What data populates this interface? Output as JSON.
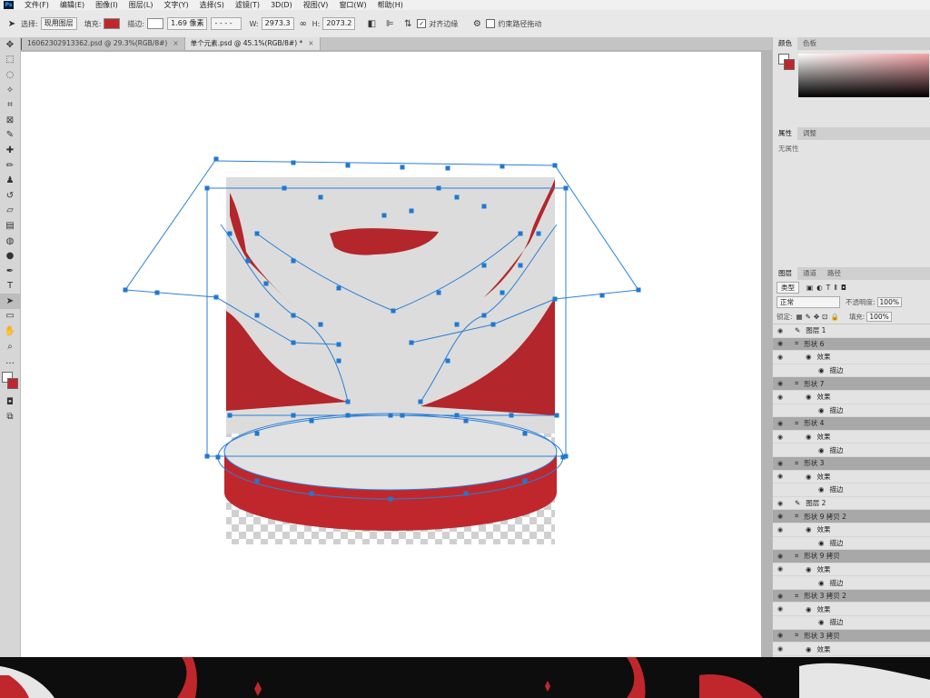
{
  "menu": [
    "文件(F)",
    "编辑(E)",
    "图像(I)",
    "图层(L)",
    "文字(Y)",
    "选择(S)",
    "滤镜(T)",
    "3D(D)",
    "视图(V)",
    "窗口(W)",
    "帮助(H)"
  ],
  "options": {
    "pick_label": "选择:",
    "pick_value": "现用图层",
    "fill_label": "填充:",
    "fill_color": "#c0272d",
    "stroke_label": "描边:",
    "stroke_width": "1.69 像素",
    "w_label": "W:",
    "w_value": "2973.3",
    "h_label": "H:",
    "h_value": "2073.2",
    "align_edges_label": "对齐边缘",
    "constrain_label": "约束路径拖动"
  },
  "tabs": [
    {
      "label": "16062302913362.psd @ 29.3%(RGB/8#)",
      "active": false
    },
    {
      "label": "单个元素.psd @ 45.1%(RGB/8#) *",
      "active": true
    }
  ],
  "color_panel": {
    "tabs": [
      "颜色",
      "色板"
    ],
    "fg": "#ffffff",
    "bg": "#c0272d"
  },
  "props_panel": {
    "tabs": [
      "属性",
      "调整"
    ],
    "empty_text": "无属性"
  },
  "layers_panel": {
    "tabs": [
      "图层",
      "通道",
      "路径"
    ],
    "filter_label": "类型",
    "blend_mode": "正常",
    "opacity_label": "不透明度:",
    "opacity": "100%",
    "lock_label": "锁定:",
    "fill_label": "填充:",
    "fill": "100%",
    "rows": [
      {
        "name": "图层 1",
        "level": 0,
        "kind": "brush",
        "selected": false
      },
      {
        "name": "形状 6",
        "level": 0,
        "kind": "shape",
        "selected": true
      },
      {
        "name": "效果",
        "level": 1,
        "kind": "fx",
        "selected": false
      },
      {
        "name": "描边",
        "level": 2,
        "kind": "fx",
        "selected": false
      },
      {
        "name": "形状 7",
        "level": 0,
        "kind": "shape",
        "selected": true
      },
      {
        "name": "效果",
        "level": 1,
        "kind": "fx",
        "selected": false
      },
      {
        "name": "描边",
        "level": 2,
        "kind": "fx",
        "selected": false
      },
      {
        "name": "形状 4",
        "level": 0,
        "kind": "shape",
        "selected": true
      },
      {
        "name": "效果",
        "level": 1,
        "kind": "fx",
        "selected": false
      },
      {
        "name": "描边",
        "level": 2,
        "kind": "fx",
        "selected": false
      },
      {
        "name": "形状 3",
        "level": 0,
        "kind": "shape",
        "selected": true
      },
      {
        "name": "效果",
        "level": 1,
        "kind": "fx",
        "selected": false
      },
      {
        "name": "描边",
        "level": 2,
        "kind": "fx",
        "selected": false
      },
      {
        "name": "图层 2",
        "level": 0,
        "kind": "brush",
        "selected": false
      },
      {
        "name": "形状 9 拷贝 2",
        "level": 0,
        "kind": "shape",
        "selected": true
      },
      {
        "name": "效果",
        "level": 1,
        "kind": "fx",
        "selected": false
      },
      {
        "name": "描边",
        "level": 2,
        "kind": "fx",
        "selected": false
      },
      {
        "name": "形状 9 拷贝",
        "level": 0,
        "kind": "shape",
        "selected": true
      },
      {
        "name": "效果",
        "level": 1,
        "kind": "fx",
        "selected": false
      },
      {
        "name": "描边",
        "level": 2,
        "kind": "fx",
        "selected": false
      },
      {
        "name": "形状 3 拷贝 2",
        "level": 0,
        "kind": "shape",
        "selected": true
      },
      {
        "name": "效果",
        "level": 1,
        "kind": "fx",
        "selected": false
      },
      {
        "name": "描边",
        "level": 2,
        "kind": "fx",
        "selected": false
      },
      {
        "name": "形状 3 拷贝",
        "level": 0,
        "kind": "shape",
        "selected": true
      },
      {
        "name": "效果",
        "level": 1,
        "kind": "fx",
        "selected": false
      }
    ]
  },
  "colors": {
    "accent_red": "#c0272d",
    "path_blue": "#2b7fd6",
    "stage_gray": "#dcdcdc"
  }
}
